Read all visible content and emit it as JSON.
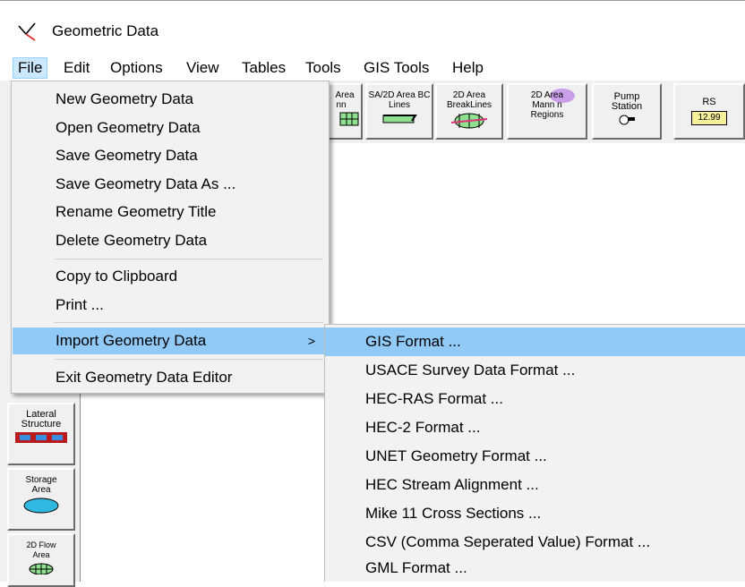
{
  "window": {
    "title": "Geometric Data"
  },
  "menubar": {
    "items": [
      {
        "label": "File"
      },
      {
        "label": "Edit"
      },
      {
        "label": "Options"
      },
      {
        "label": "View"
      },
      {
        "label": "Tables"
      },
      {
        "label": "Tools"
      },
      {
        "label": "GIS Tools"
      },
      {
        "label": "Help"
      }
    ]
  },
  "toolbar": {
    "partial1": "Area",
    "partial1_sub": "nn",
    "sa_bc_lines": "SA/2D Area BC Lines",
    "breaklines": "2D Area BreakLines",
    "mann_regions": "2D Area Mann n Regions",
    "pump_station": "Pump Station",
    "rs": "RS",
    "rs_value": "12.99"
  },
  "lefttoolbar": {
    "lateral_structure": "Lateral Structure",
    "storage_area": "Storage Area",
    "flow_area": "2D Flow Area"
  },
  "file_menu": {
    "items": [
      "New Geometry Data",
      "Open Geometry Data",
      "Save Geometry Data",
      "Save Geometry Data As ...",
      "Rename Geometry Title",
      "Delete Geometry Data",
      "Copy to Clipboard",
      "Print ...",
      "Import Geometry Data",
      "Exit Geometry Data Editor"
    ],
    "submenu_arrow": ">"
  },
  "import_submenu": {
    "items": [
      "GIS Format ...",
      "USACE Survey Data Format ...",
      "HEC-RAS Format ...",
      "HEC-2 Format ...",
      "UNET Geometry Format ...",
      "HEC Stream Alignment ...",
      "Mike 11 Cross Sections ...",
      "CSV (Comma Seperated Value) Format ...",
      "GML Format ..."
    ]
  },
  "colors": {
    "highlight": "#91c9f7",
    "menu_bg": "#f2f2f2",
    "menubar_active": "#cce8ff"
  }
}
